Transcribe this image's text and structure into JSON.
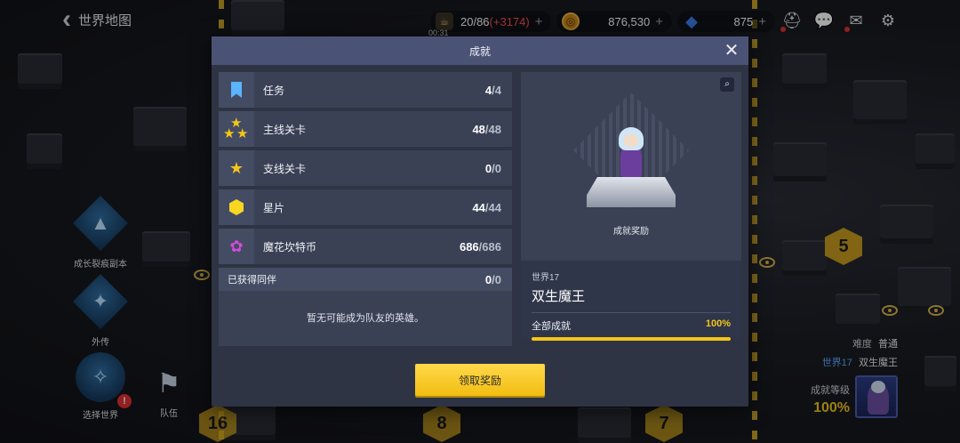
{
  "topbar": {
    "back_title": "世界地图",
    "stamina": {
      "current": "20",
      "max": "/86",
      "bonus": "(+3174)",
      "timer": "00:31"
    },
    "gold": {
      "value": "876,530"
    },
    "gems": {
      "value": "875"
    },
    "plus": "+"
  },
  "side_menu": [
    {
      "label": "成长裂痕副本",
      "icon": "rift-emblem-icon"
    },
    {
      "label": "外传",
      "icon": "side-story-emblem-icon"
    },
    {
      "label": "选择世界",
      "icon": "compass-icon"
    },
    {
      "label": "队伍",
      "icon": "flag-icon"
    }
  ],
  "map": {
    "numbers": [
      "5",
      "16",
      "8",
      "7"
    ]
  },
  "info_card": {
    "difficulty_label": "难度",
    "difficulty_value": "普通",
    "world": "世界17",
    "stage": "双生魔王",
    "level_label": "成就等级",
    "level_value": "100%"
  },
  "modal": {
    "title": "成就",
    "close": "✕",
    "rows": [
      {
        "name": "任务",
        "count": "4",
        "total": "4",
        "icon": "bookmark-icon"
      },
      {
        "name": "主线关卡",
        "count": "48",
        "total": "48",
        "icon": "three-stars-icon"
      },
      {
        "name": "支线关卡",
        "count": "0",
        "total": "0",
        "icon": "star-icon"
      },
      {
        "name": "星片",
        "count": "44",
        "total": "44",
        "icon": "star-shard-icon"
      },
      {
        "name": "魔花坎特币",
        "count": "686",
        "total": "686",
        "icon": "flower-coin-icon"
      }
    ],
    "companion": {
      "label": "已获得同伴",
      "count": "0",
      "total": "0",
      "empty_text": "暂无可能成为队友的英雄。"
    },
    "reward": {
      "art_label": "成就奖励",
      "world": "世界17",
      "boss": "双生魔王",
      "all_label": "全部成就",
      "percent": "100%",
      "progress": 1.0
    },
    "claim_label": "领取奖励"
  },
  "colors": {
    "accent_gold": "#f5c518",
    "modal_header": "#4a5376",
    "bonus_red": "#ff4f4f",
    "gem_blue": "#3d7ff0"
  }
}
